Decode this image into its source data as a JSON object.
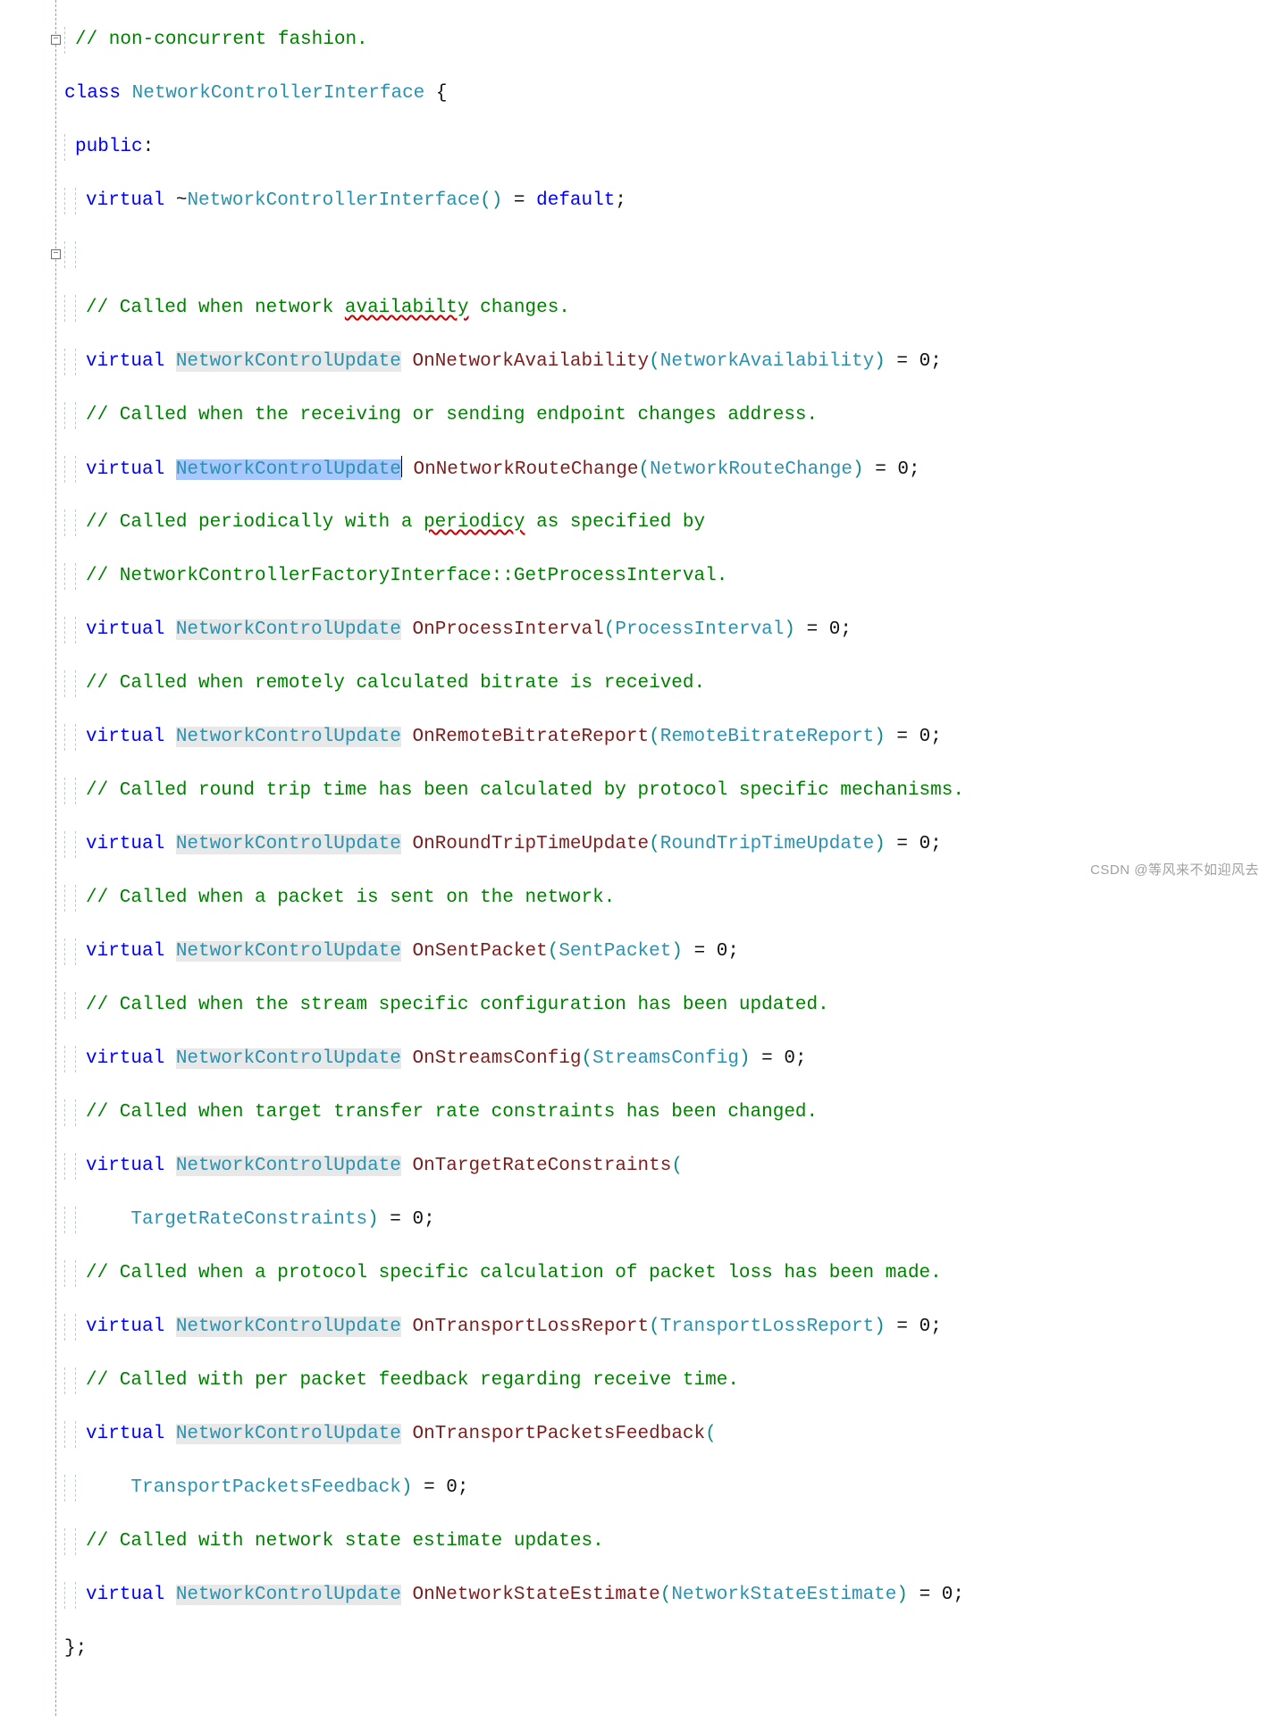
{
  "watermark": "CSDN @等风来不如迎风去",
  "code": {
    "l00_comment": "// non-concurrent fashion.",
    "l01_kw_class": "class",
    "l01_type": "NetworkControllerInterface",
    "l01_brace": " {",
    "l02_kw": "public",
    "l02_colon": ":",
    "l03_kw": "virtual",
    "l03_dtor_tilde": "~",
    "l03_dtor_name": "NetworkControllerInterface",
    "l03_parens": "()",
    "l03_eq": " = ",
    "l03_default": "default",
    "l03_semi": ";",
    "l05_cmt_a": "// Called when network ",
    "l05_cmt_b": "availabilty",
    "l05_cmt_c": " changes.",
    "l06_kw": "virtual",
    "l06_ret": "NetworkControlUpdate",
    "l06_fn": "OnNetworkAvailability",
    "l06_arg": "NetworkAvailability",
    "l06_tail": " = 0;",
    "l07_cmt": "// Called when the receiving or sending endpoint changes address.",
    "l08_kw": "virtual",
    "l08_ret": "NetworkControlUpdate",
    "l08_fn": "OnNetworkRouteChange",
    "l08_arg": "NetworkRouteChange",
    "l08_tail": " = 0;",
    "l09_cmt_a": "// Called periodically with a ",
    "l09_cmt_b": "periodicy",
    "l09_cmt_c": " as specified by",
    "l10_cmt": "// NetworkControllerFactoryInterface::GetProcessInterval.",
    "l11_kw": "virtual",
    "l11_ret": "NetworkControlUpdate",
    "l11_fn": "OnProcessInterval",
    "l11_arg": "ProcessInterval",
    "l11_tail": " = 0;",
    "l12_cmt": "// Called when remotely calculated bitrate is received.",
    "l13_kw": "virtual",
    "l13_ret": "NetworkControlUpdate",
    "l13_fn": "OnRemoteBitrateReport",
    "l13_arg": "RemoteBitrateReport",
    "l13_tail": " = 0;",
    "l14_cmt": "// Called round trip time has been calculated by protocol specific mechanisms.",
    "l15_kw": "virtual",
    "l15_ret": "NetworkControlUpdate",
    "l15_fn": "OnRoundTripTimeUpdate",
    "l15_arg": "RoundTripTimeUpdate",
    "l15_tail": " = 0;",
    "l16_cmt": "// Called when a packet is sent on the network.",
    "l17_kw": "virtual",
    "l17_ret": "NetworkControlUpdate",
    "l17_fn": "OnSentPacket",
    "l17_arg": "SentPacket",
    "l17_tail": " = 0;",
    "l18_cmt": "// Called when the stream specific configuration has been updated.",
    "l19_kw": "virtual",
    "l19_ret": "NetworkControlUpdate",
    "l19_fn": "OnStreamsConfig",
    "l19_arg": "StreamsConfig",
    "l19_tail": " = 0;",
    "l20_cmt": "// Called when target transfer rate constraints has been changed.",
    "l21_kw": "virtual",
    "l21_ret": "NetworkControlUpdate",
    "l21_fn": "OnTargetRateConstraints",
    "l21_open": "(",
    "l22_arg": "TargetRateConstraints",
    "l22_close": ")",
    "l22_tail": " = 0;",
    "l23_cmt": "// Called when a protocol specific calculation of packet loss has been made.",
    "l24_kw": "virtual",
    "l24_ret": "NetworkControlUpdate",
    "l24_fn": "OnTransportLossReport",
    "l24_arg": "TransportLossReport",
    "l24_tail": " = 0;",
    "l25_cmt": "// Called with per packet feedback regarding receive time.",
    "l26_kw": "virtual",
    "l26_ret": "NetworkControlUpdate",
    "l26_fn": "OnTransportPacketsFeedback",
    "l26_open": "(",
    "l27_arg": "TransportPacketsFeedback",
    "l27_close": ")",
    "l27_tail": " = 0;",
    "l28_cmt": "// Called with network state estimate updates.",
    "l29_kw": "virtual",
    "l29_ret": "NetworkControlUpdate",
    "l29_fn": "OnNetworkStateEstimate",
    "l29_arg": "NetworkStateEstimate",
    "l29_tail": " = 0;",
    "l30_close": "};"
  }
}
